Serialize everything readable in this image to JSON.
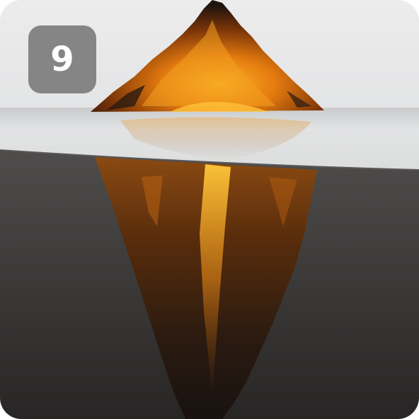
{
  "badge": {
    "number": "9"
  },
  "image": {
    "subject": "molten-lava-iceberg",
    "colors": {
      "sky": "#e9e9ea",
      "water_surface": "#d9dadb",
      "underwater_top": "#4a4848",
      "underwater_bottom": "#2a2827",
      "rock_dark": "#1d140f",
      "lava_glow": "#f08a12",
      "lava_bright": "#ffc23a",
      "badge_background": "#858585",
      "badge_text": "#ffffff"
    }
  }
}
